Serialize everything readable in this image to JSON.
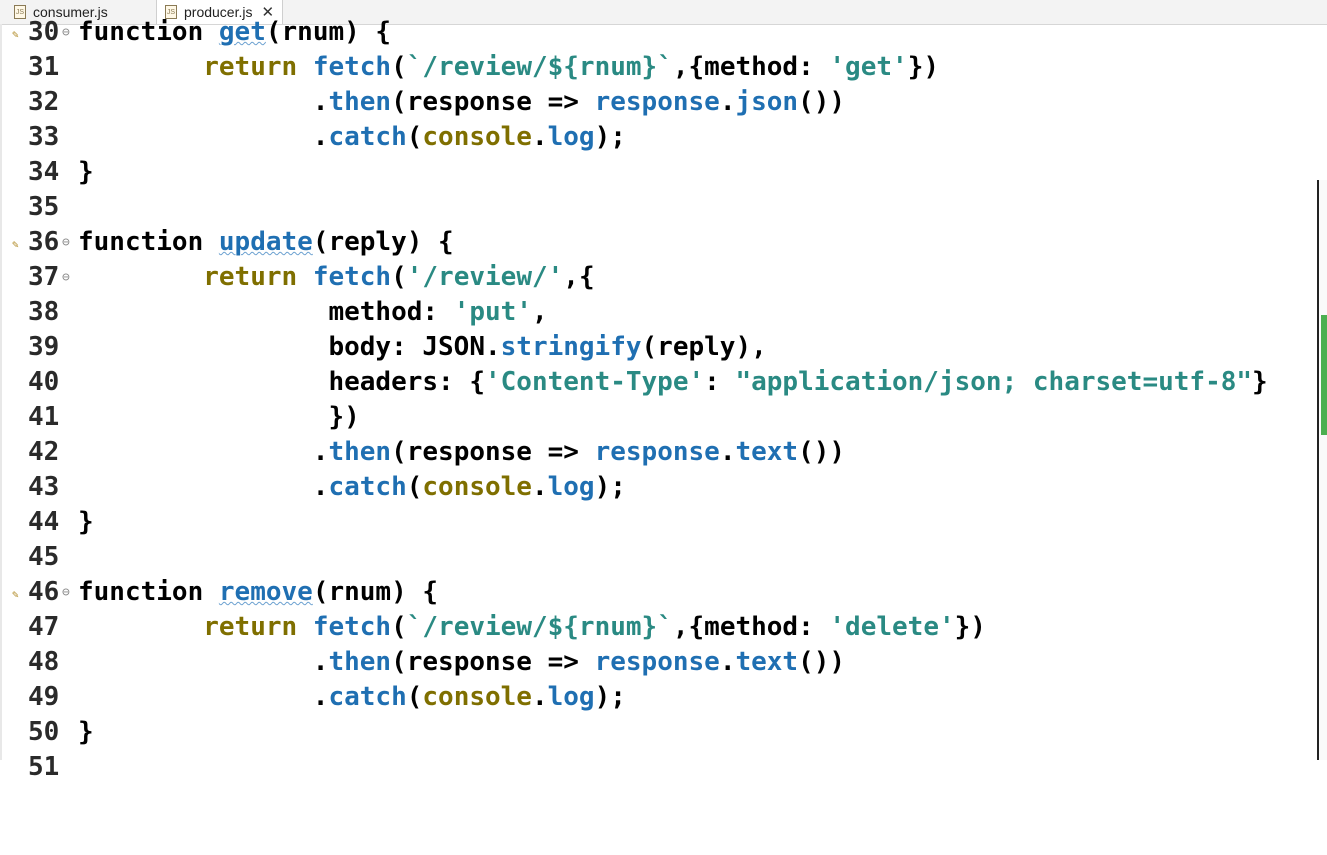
{
  "tabs": [
    {
      "label": "consumer.js",
      "active": false,
      "icon": "js-file-icon"
    },
    {
      "label": "producer.js",
      "active": true,
      "icon": "js-file-icon",
      "close": "✕"
    }
  ],
  "code_lines": [
    {
      "num": "30",
      "text": "function get(rnum) {"
    },
    {
      "num": "31",
      "text": "        return fetch(`/review/${rnum}`,{method: 'get'})"
    },
    {
      "num": "32",
      "text": "               .then(response => response.json())"
    },
    {
      "num": "33",
      "text": "               .catch(console.log);"
    },
    {
      "num": "34",
      "text": "}"
    },
    {
      "num": "35",
      "text": ""
    },
    {
      "num": "36",
      "text": "function update(reply) {"
    },
    {
      "num": "37",
      "text": "        return fetch('/review/',{"
    },
    {
      "num": "38",
      "text": "                method: 'put',"
    },
    {
      "num": "39",
      "text": "                body: JSON.stringify(reply),"
    },
    {
      "num": "40",
      "text": "                headers: {'Content-Type': \"application/json; charset=utf-8\"}"
    },
    {
      "num": "41",
      "text": "                })"
    },
    {
      "num": "42",
      "text": "               .then(response => response.text())"
    },
    {
      "num": "43",
      "text": "               .catch(console.log);"
    },
    {
      "num": "44",
      "text": "}"
    },
    {
      "num": "45",
      "text": ""
    },
    {
      "num": "46",
      "text": "function remove(rnum) {"
    },
    {
      "num": "47",
      "text": "        return fetch(`/review/${rnum}`,{method: 'delete'})"
    },
    {
      "num": "48",
      "text": "               .then(response => response.text())"
    },
    {
      "num": "49",
      "text": "               .catch(console.log);"
    },
    {
      "num": "50",
      "text": "}"
    },
    {
      "num": "51",
      "text": ""
    }
  ],
  "colors": {
    "keyword": "#7f6f00",
    "function_call": "#1f6fb2",
    "string": "#2a8a83",
    "overview_mark": "#4caf50"
  }
}
